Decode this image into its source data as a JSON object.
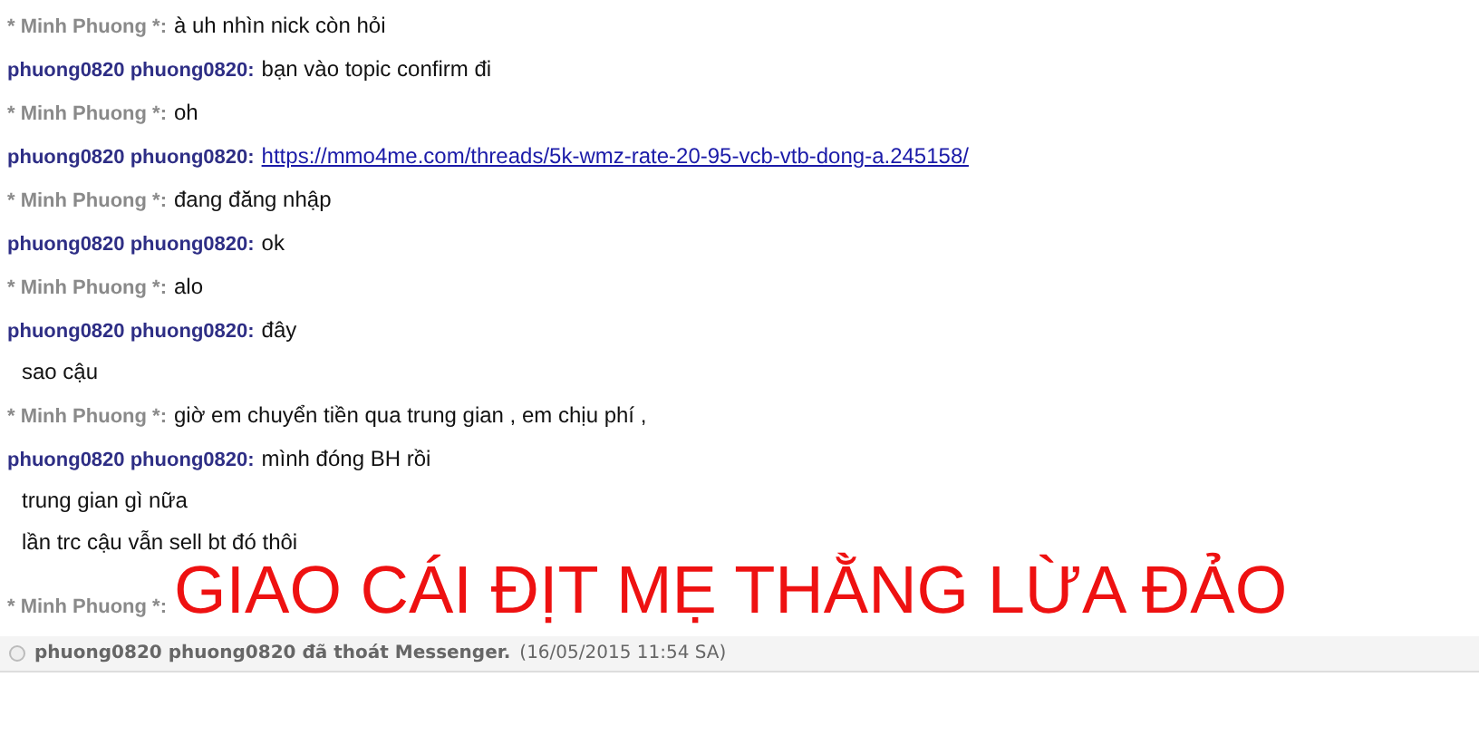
{
  "messages": [
    {
      "sender": "* Minh Phuong *:",
      "kind": "other",
      "lines": [
        {
          "kind": "text",
          "text": "à uh nhìn nick còn hỏi"
        }
      ]
    },
    {
      "sender": "phuong0820 phuong0820:",
      "kind": "self",
      "lines": [
        {
          "kind": "text",
          "text": "bạn vào topic confirm đi"
        }
      ]
    },
    {
      "sender": "* Minh Phuong *:",
      "kind": "other",
      "lines": [
        {
          "kind": "text",
          "text": "oh"
        }
      ]
    },
    {
      "sender": "phuong0820 phuong0820:",
      "kind": "self",
      "lines": [
        {
          "kind": "link",
          "text": "https://mmo4me.com/threads/5k-wmz-rate-20-95-vcb-vtb-dong-a.245158/"
        }
      ]
    },
    {
      "sender": "* Minh Phuong *:",
      "kind": "other",
      "lines": [
        {
          "kind": "text",
          "text": "đang đăng nhập"
        }
      ]
    },
    {
      "sender": "phuong0820 phuong0820:",
      "kind": "self",
      "lines": [
        {
          "kind": "text",
          "text": "ok"
        }
      ]
    },
    {
      "sender": "* Minh Phuong *:",
      "kind": "other",
      "lines": [
        {
          "kind": "text",
          "text": "alo"
        }
      ]
    },
    {
      "sender": "phuong0820 phuong0820:",
      "kind": "self",
      "lines": [
        {
          "kind": "text",
          "text": "đây"
        },
        {
          "kind": "text",
          "text": "sao cậu"
        }
      ]
    },
    {
      "sender": "* Minh Phuong *:",
      "kind": "other",
      "lines": [
        {
          "kind": "text",
          "text": "giờ em chuyển tiền qua trung gian , em chịu phí ,"
        }
      ]
    },
    {
      "sender": "phuong0820 phuong0820:",
      "kind": "self",
      "lines": [
        {
          "kind": "text",
          "text": "mình đóng BH rồi"
        },
        {
          "kind": "text",
          "text": "trung gian gì nữa"
        },
        {
          "kind": "text",
          "text": "lần trc cậu vẫn sell bt đó thôi"
        }
      ]
    },
    {
      "sender": "* Minh Phuong *:",
      "kind": "other",
      "lines": [
        {
          "kind": "shout",
          "text": "GIAO CÁI ĐỊT MẸ THẰNG LỪA ĐẢO"
        }
      ]
    }
  ],
  "status": {
    "text": "phuong0820 phuong0820 đã thoát Messenger.",
    "time": "(16/05/2015 11:54 SA)"
  }
}
